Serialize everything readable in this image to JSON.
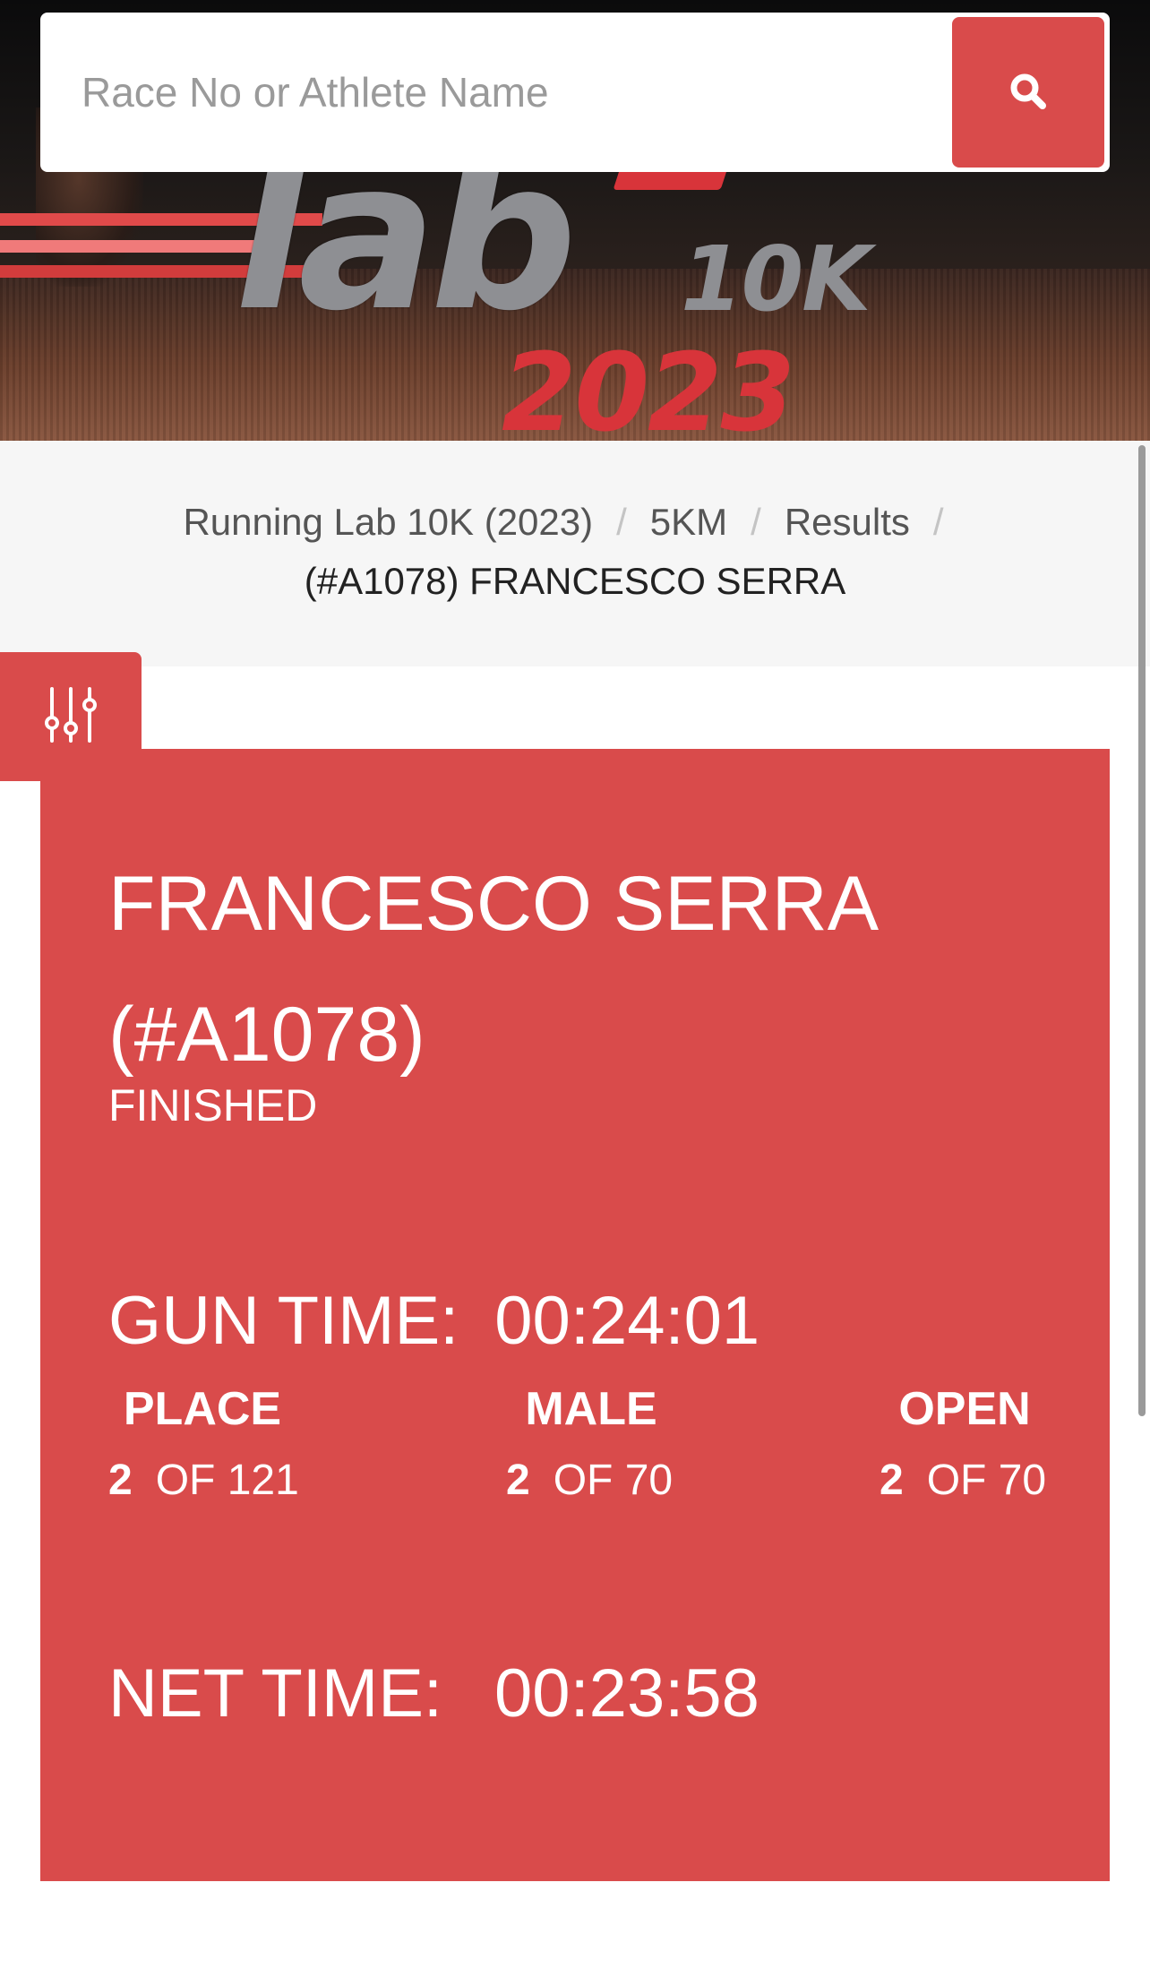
{
  "hero": {
    "logo_text": "lab",
    "logo_distance": "10K",
    "logo_year": "2023"
  },
  "search": {
    "placeholder": "Race No or Athlete Name",
    "button_icon": "search-icon"
  },
  "breadcrumb": {
    "items": [
      "Running Lab 10K (2023)",
      "5KM",
      "Results"
    ],
    "separator": "/",
    "current": "(#A1078) FRANCESCO SERRA"
  },
  "filter": {
    "icon": "sliders-icon"
  },
  "result": {
    "athlete_name": "FRANCESCO SERRA",
    "bib": "(#A1078)",
    "status": "FINISHED",
    "gun_time_label": "GUN TIME:",
    "gun_time": "00:24:01",
    "net_time_label": "NET TIME:",
    "net_time": "00:23:58",
    "placings": [
      {
        "label": "PLACE",
        "rank": "2",
        "of_text": "OF 121"
      },
      {
        "label": "MALE",
        "rank": "2",
        "of_text": "OF 70"
      },
      {
        "label": "OPEN",
        "rank": "2",
        "of_text": "OF 70"
      }
    ]
  },
  "colors": {
    "accent": "#d94b4b",
    "breadcrumb_bg": "#f6f6f6",
    "text_on_accent": "#ffffff"
  }
}
